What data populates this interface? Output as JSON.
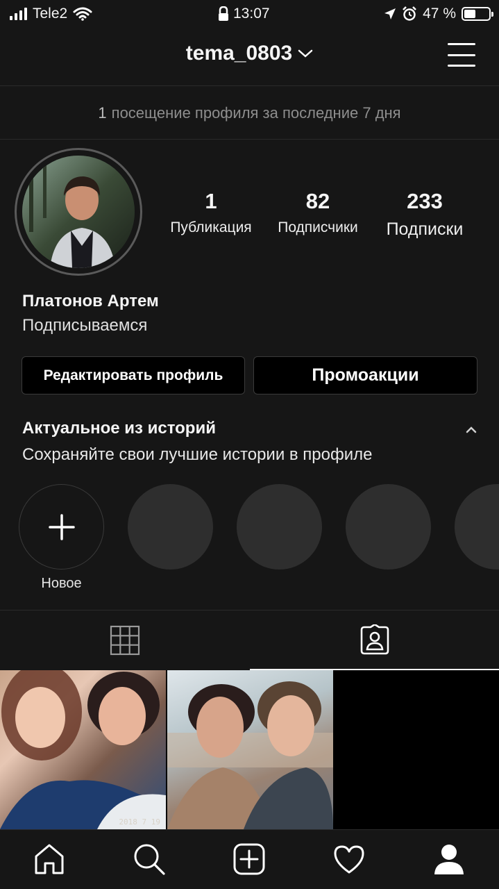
{
  "status_bar": {
    "carrier": "Tele2",
    "time": "13:07",
    "battery_percent": "47 %",
    "battery_level": 0.47
  },
  "header": {
    "username": "tema_0803"
  },
  "visits": {
    "count": "1",
    "text": "посещение профиля за последние 7 дня"
  },
  "stats": [
    {
      "value": "1",
      "label": "Публикация"
    },
    {
      "value": "82",
      "label": "Подписчики"
    },
    {
      "value": "233",
      "label": "Подписки"
    }
  ],
  "profile": {
    "name": "Платонов Артем",
    "bio": "Подписываемся"
  },
  "buttons": {
    "edit_profile": "Редактировать профиль",
    "promotions": "Промоакции"
  },
  "highlights": {
    "title": "Актуальное из историй",
    "subtitle": "Сохраняйте свои лучшие истории в профиле",
    "new_label": "Новое"
  },
  "photos": {
    "photo_1_date": "2018 7 19"
  },
  "icons": {
    "wifi": "wifi-icon",
    "lock": "lock-icon",
    "location": "location-arrow-icon",
    "alarm": "alarm-icon",
    "menu": "hamburger-menu-icon",
    "grid": "grid-icon",
    "tagged": "tagged-person-icon",
    "home": "home-icon",
    "search": "search-icon",
    "add": "add-post-icon",
    "heart": "heart-icon",
    "profile": "profile-icon"
  }
}
